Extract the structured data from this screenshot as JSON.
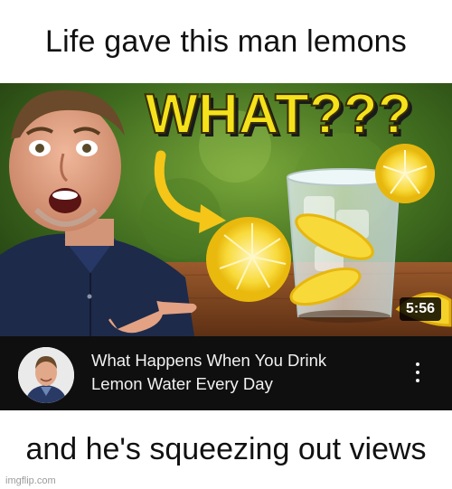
{
  "meme": {
    "top_caption": "Life gave this man lemons",
    "bottom_caption": "and he's squeezing out views",
    "watermark": "imgflip.com"
  },
  "video": {
    "thumbnail_text": "WHAT???",
    "duration": "5:56",
    "title_line_1": "What Happens When You Drink",
    "title_line_2": "Lemon Water Every Day",
    "more_icon": "more-vert-icon"
  },
  "colors": {
    "thumbnail_headline": "#f5e21c",
    "card_background": "#0f0f0f",
    "title_text": "#f1f1f1",
    "arrow": "#f5c518"
  }
}
